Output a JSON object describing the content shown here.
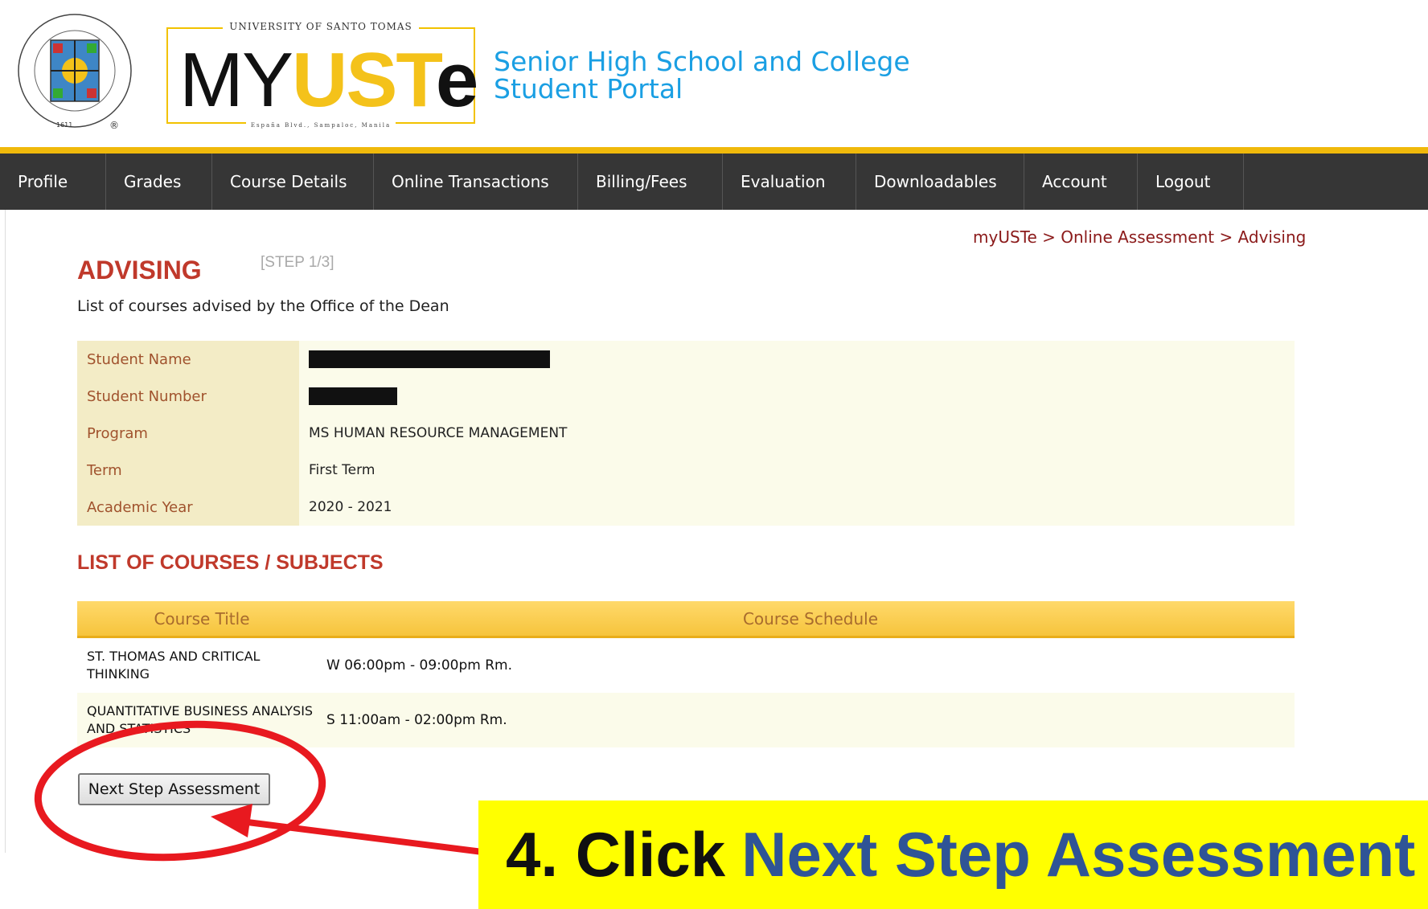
{
  "header": {
    "university_name": "UNIVERSITY OF SANTO TOMAS",
    "logo": {
      "my": "MY",
      "ust": "UST",
      "e": "e"
    },
    "address": "España Blvd., Sampaloc, Manila",
    "portal_title_line1": "Senior High School and College",
    "portal_title_line2": "Student Portal",
    "seal_icon": "ust-seal-icon"
  },
  "nav": {
    "items": [
      "Profile",
      "Grades",
      "Course Details",
      "Online Transactions",
      "Billing/Fees",
      "Evaluation",
      "Downloadables",
      "Account",
      "Logout"
    ]
  },
  "breadcrumb": "myUSTe > Online Assessment > Advising",
  "page": {
    "title": "ADVISING",
    "step": "[STEP 1/3]",
    "description": "List of courses advised by the Office of the Dean"
  },
  "student_info": {
    "rows": [
      {
        "label": "Student Name",
        "value": ""
      },
      {
        "label": "Student Number",
        "value": ""
      },
      {
        "label": "Program",
        "value": "MS HUMAN RESOURCE MANAGEMENT"
      },
      {
        "label": "Term",
        "value": "First Term"
      },
      {
        "label": "Academic Year",
        "value": "2020 - 2021"
      }
    ]
  },
  "courses": {
    "heading": "LIST OF COURSES / SUBJECTS",
    "columns": [
      "Course Title",
      "Course Schedule"
    ],
    "rows": [
      {
        "title": "ST. THOMAS AND CRITICAL THINKING",
        "schedule": "W 06:00pm - 09:00pm Rm."
      },
      {
        "title": "QUANTITATIVE BUSINESS ANALYSIS AND STATISTICS",
        "schedule": "S 11:00am - 02:00pm Rm."
      }
    ]
  },
  "next_button": "Next Step Assessment",
  "annotation": {
    "prefix": "4. Click",
    "highlight": "Next Step Assessment",
    "banner_color": "#ffff00",
    "highlight_color": "#2f5496",
    "marker_color": "#e8191f"
  }
}
